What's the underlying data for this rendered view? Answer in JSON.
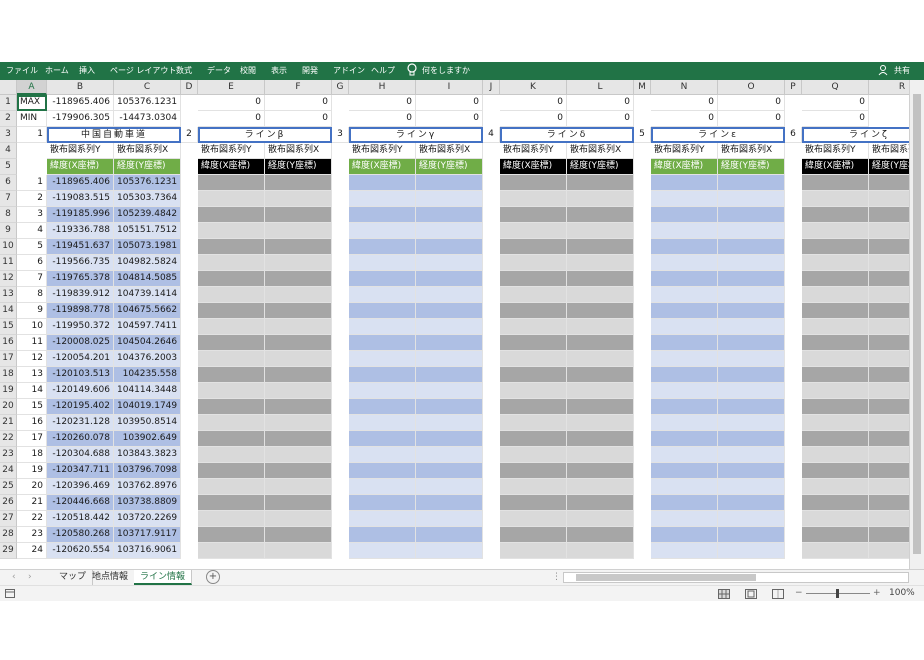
{
  "ribbon": {
    "tabs": [
      "ファイル",
      "ホーム",
      "挿入",
      "ページ レイアウト",
      "数式",
      "データ",
      "校閲",
      "表示",
      "開発",
      "アドイン",
      "ヘルプ"
    ],
    "tell_me": "何をしますか",
    "share": "共有"
  },
  "columns": [
    "A",
    "B",
    "C",
    "D",
    "E",
    "F",
    "G",
    "H",
    "I",
    "J",
    "K",
    "L",
    "M",
    "N",
    "O",
    "P",
    "Q",
    "R"
  ],
  "row_numbers": [
    "1",
    "2",
    "3",
    "4",
    "5",
    "6",
    "7",
    "8",
    "9",
    "10",
    "11",
    "12",
    "13",
    "14",
    "15",
    "16",
    "17",
    "18",
    "19",
    "20",
    "21",
    "22",
    "23",
    "24",
    "25",
    "26",
    "27",
    "28",
    "29"
  ],
  "summary": {
    "max_label": "MAX",
    "min_label": "MIN",
    "max_b": "-118965.406",
    "max_c": "105376.1231",
    "min_b": "-179906.305",
    "min_c": "-14473.0304",
    "zero": "0"
  },
  "lines": [
    {
      "index": "1",
      "name": "中国自動車道"
    },
    {
      "index": "2",
      "name": "ラインβ"
    },
    {
      "index": "3",
      "name": "ラインγ"
    },
    {
      "index": "4",
      "name": "ラインδ"
    },
    {
      "index": "5",
      "name": "ラインε"
    },
    {
      "index": "6",
      "name": "ラインζ"
    }
  ],
  "series_labels": {
    "y": "散布図系列Y",
    "x": "散布図系列X"
  },
  "column_headers": {
    "lat": "緯度(X座標)",
    "lon": "経度(Y座標)"
  },
  "data_rows": [
    {
      "n": "1",
      "lat": "-118965.406",
      "lon": "105376.1231"
    },
    {
      "n": "2",
      "lat": "-119083.515",
      "lon": "105303.7364"
    },
    {
      "n": "3",
      "lat": "-119185.996",
      "lon": "105239.4842"
    },
    {
      "n": "4",
      "lat": "-119336.788",
      "lon": "105151.7512"
    },
    {
      "n": "5",
      "lat": "-119451.637",
      "lon": "105073.1981"
    },
    {
      "n": "6",
      "lat": "-119566.735",
      "lon": "104982.5824"
    },
    {
      "n": "7",
      "lat": "-119765.378",
      "lon": "104814.5085"
    },
    {
      "n": "8",
      "lat": "-119839.912",
      "lon": "104739.1414"
    },
    {
      "n": "9",
      "lat": "-119898.778",
      "lon": "104675.5662"
    },
    {
      "n": "10",
      "lat": "-119950.372",
      "lon": "104597.7411"
    },
    {
      "n": "11",
      "lat": "-120008.025",
      "lon": "104504.2646"
    },
    {
      "n": "12",
      "lat": "-120054.201",
      "lon": "104376.2003"
    },
    {
      "n": "13",
      "lat": "-120103.513",
      "lon": "104235.558"
    },
    {
      "n": "14",
      "lat": "-120149.606",
      "lon": "104114.3448"
    },
    {
      "n": "15",
      "lat": "-120195.402",
      "lon": "104019.1749"
    },
    {
      "n": "16",
      "lat": "-120231.128",
      "lon": "103950.8514"
    },
    {
      "n": "17",
      "lat": "-120260.078",
      "lon": "103902.649"
    },
    {
      "n": "18",
      "lat": "-120304.688",
      "lon": "103843.3823"
    },
    {
      "n": "19",
      "lat": "-120347.711",
      "lon": "103796.7098"
    },
    {
      "n": "20",
      "lat": "-120396.469",
      "lon": "103762.8976"
    },
    {
      "n": "21",
      "lat": "-120446.668",
      "lon": "103738.8809"
    },
    {
      "n": "22",
      "lat": "-120518.442",
      "lon": "103720.2269"
    },
    {
      "n": "23",
      "lat": "-120580.268",
      "lon": "103717.9117"
    },
    {
      "n": "24",
      "lat": "-120620.554",
      "lon": "103716.9061"
    }
  ],
  "sheet_tabs": [
    "マップ",
    "地点情報",
    "ライン情報"
  ],
  "active_sheet": "ライン情報",
  "add_sheet": "+",
  "zoom": "100%",
  "colors": {
    "excel_green": "#217346",
    "header_green": "#70ad47",
    "title_border": "#4472c4",
    "band_blue_dark": "#aebfe4",
    "band_blue_light": "#d9e1f2",
    "band_gray_dark": "#a6a6a6",
    "band_gray_light": "#d9d9d9"
  }
}
